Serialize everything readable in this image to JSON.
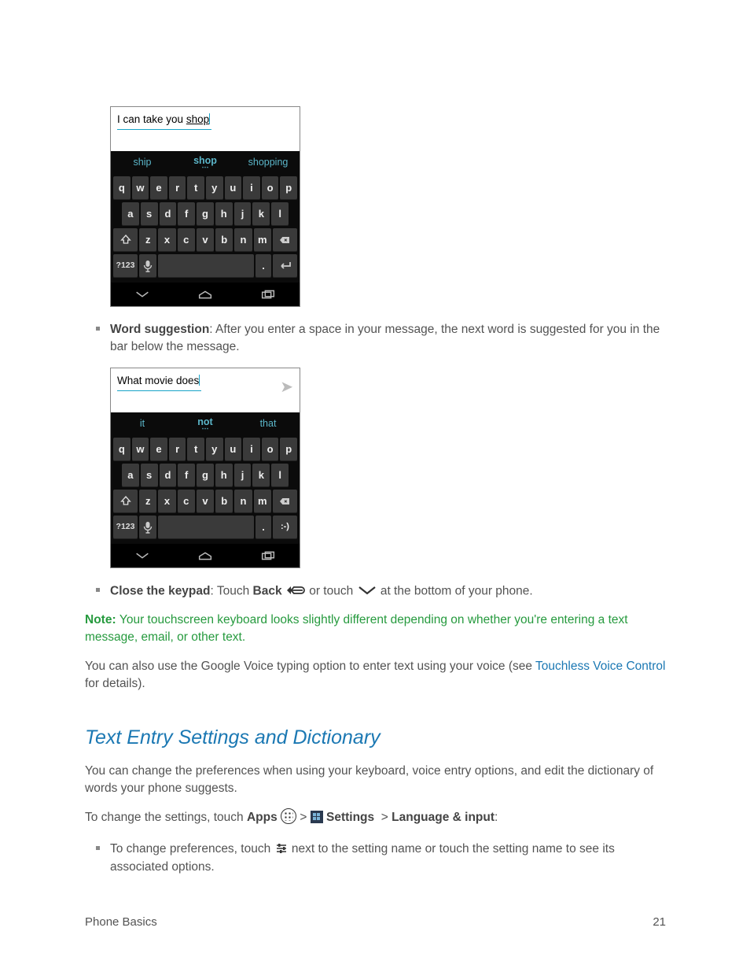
{
  "shot1": {
    "text": "I can take you ",
    "tail": "shop",
    "sugg": [
      "ship",
      "shop",
      "shopping"
    ]
  },
  "shot2": {
    "text": "What movie does",
    "sugg": [
      "it",
      "not",
      "that"
    ]
  },
  "kb": {
    "r1": [
      "q",
      "w",
      "e",
      "r",
      "t",
      "y",
      "u",
      "i",
      "o",
      "p"
    ],
    "r2": [
      "a",
      "s",
      "d",
      "f",
      "g",
      "h",
      "j",
      "k",
      "l"
    ],
    "r3": [
      "z",
      "x",
      "c",
      "v",
      "b",
      "n",
      "m"
    ],
    "sym": "?123"
  },
  "bullets": {
    "ws_lbl": "Word suggestion",
    "ws_txt": ": After you enter a space in your message, the next word is suggested for you in the bar below the message.",
    "ck_lbl": "Close the keypad",
    "ck_t1": ": Touch ",
    "ck_back": "Back",
    "ck_t2": " or touch ",
    "ck_t3": " at the bottom of your phone."
  },
  "note": {
    "lbl": "Note: ",
    "txt": "Your touchscreen keyboard looks slightly different depending on whether you're entering a text message, email, or other text."
  },
  "voice": {
    "a": "You can also use the Google Voice typing option to enter text using your voice (see ",
    "link": "Touchless Voice Control",
    "b": " for details)."
  },
  "section": "Text Entry Settings and Dictionary",
  "sec_p1": "You can change the preferences when using your keyboard, voice entry options, and edit the dictionary of words your phone suggests.",
  "sec_p2": {
    "a": "To change the settings, touch ",
    "apps": "Apps",
    "sett": "Settings",
    "lang": "Language & input",
    ":": ":"
  },
  "sec_b": {
    "a": "To change preferences, touch ",
    "b": " next to the setting name or touch the setting name to see its associated options."
  },
  "footer": {
    "l": "Phone Basics",
    "r": "21"
  },
  "smiley": ":-)",
  "dot": "."
}
